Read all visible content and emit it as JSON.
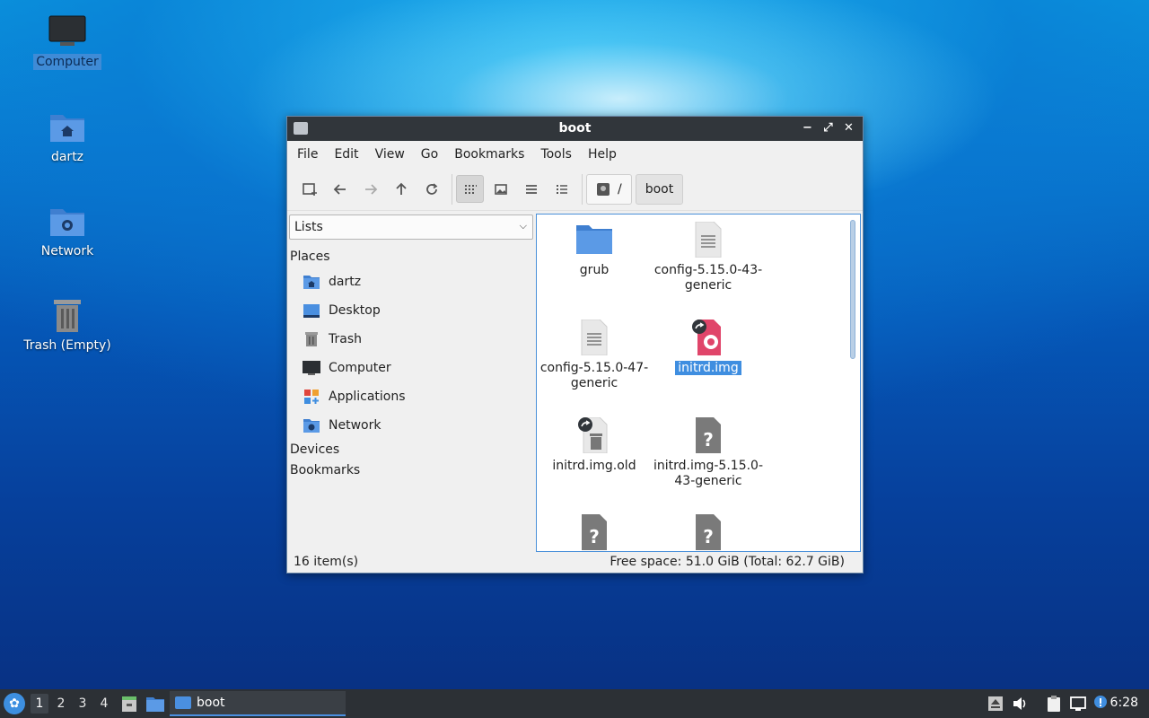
{
  "desktop": {
    "icons": [
      {
        "label": "Computer"
      },
      {
        "label": "dartz"
      },
      {
        "label": "Network"
      },
      {
        "label": "Trash (Empty)"
      }
    ]
  },
  "window": {
    "title": "boot",
    "controls": {
      "minimize": "−",
      "maximize": "⤢",
      "close": "✕"
    },
    "menu": [
      "File",
      "Edit",
      "View",
      "Go",
      "Bookmarks",
      "Tools",
      "Help"
    ],
    "path": {
      "root": "/",
      "current": "boot"
    },
    "side": {
      "select_value": "Lists",
      "places_header": "Places",
      "places": [
        "dartz",
        "Desktop",
        "Trash",
        "Computer",
        "Applications",
        "Network"
      ],
      "devices_header": "Devices",
      "bookmarks_header": "Bookmarks"
    },
    "files": [
      {
        "name": "grub"
      },
      {
        "name": "config-5.15.0-43-\ngeneric"
      },
      {
        "name": "config-5.15.0-47-\ngeneric"
      },
      {
        "name": "initrd.img"
      },
      {
        "name": "initrd.img.old"
      },
      {
        "name": "initrd.img-5.15.0-\n43-generic"
      }
    ],
    "status": {
      "items": "16 item(s)",
      "free": "Free space: 51.0 GiB (Total: 62.7 GiB)"
    }
  },
  "taskbar": {
    "menu_glyph": "✿",
    "workspaces": [
      "1",
      "2",
      "3",
      "4"
    ],
    "task": "boot",
    "clock": "6:28"
  },
  "colors": {
    "accent": "#3f8ee0",
    "titlebar": "#31363b",
    "taskbar": "#2c3035",
    "folder": "#4a8fe0"
  }
}
